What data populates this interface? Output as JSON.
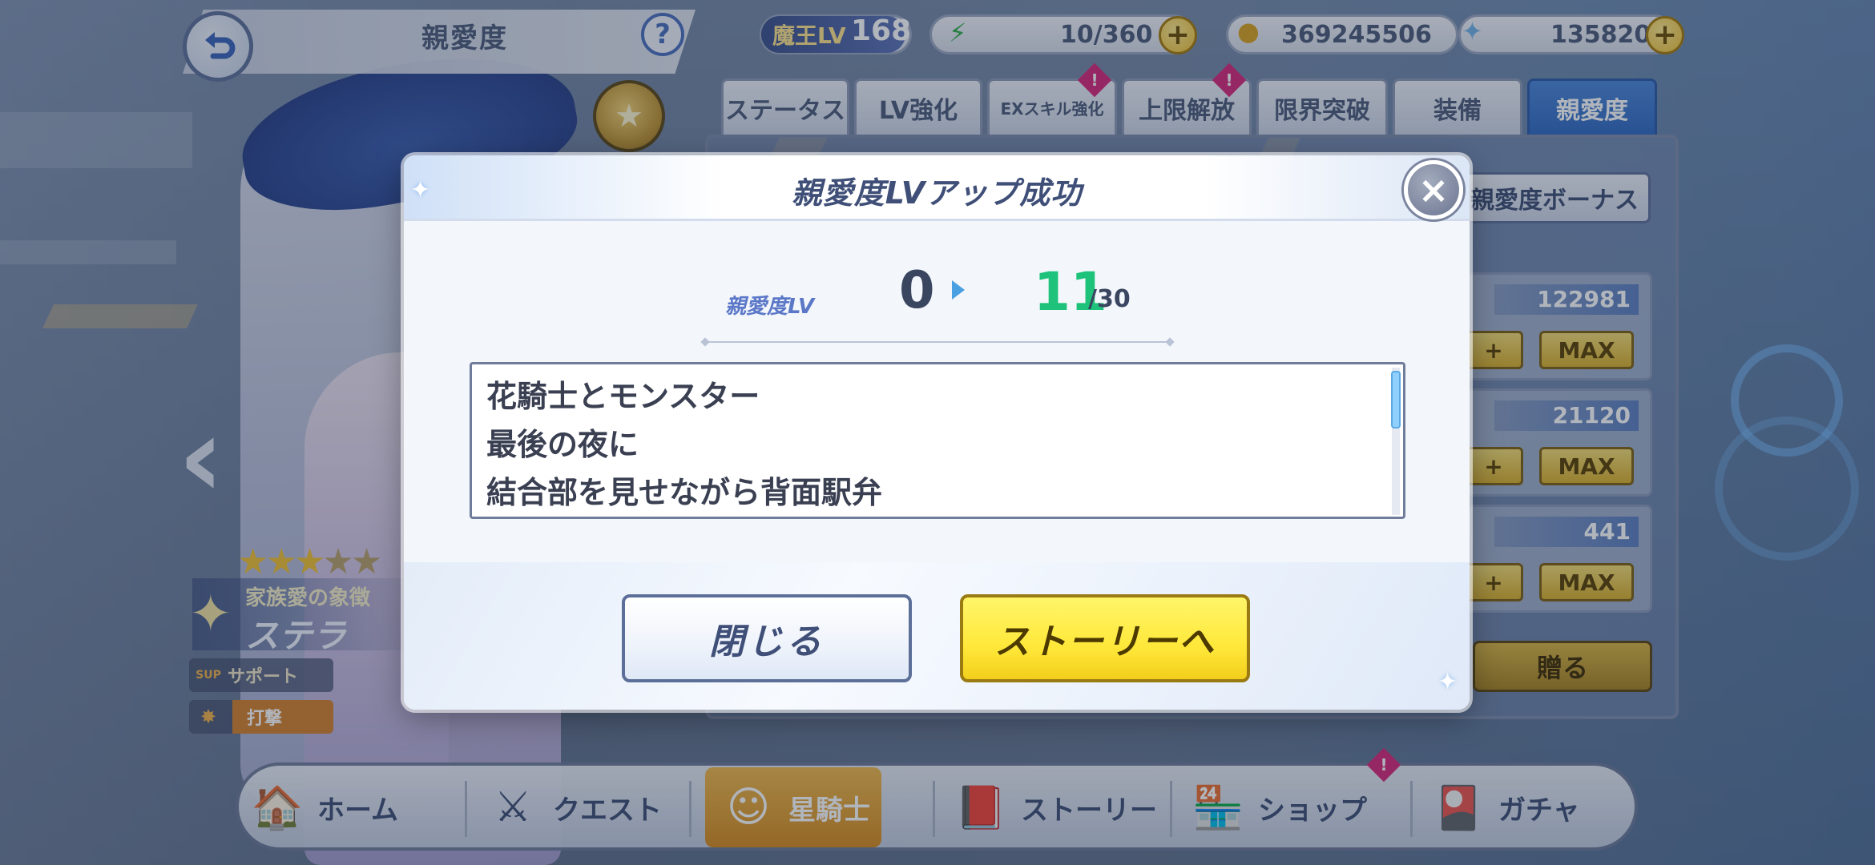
{
  "header": {
    "page_title": "親愛度",
    "back_icon": "back-arrow-icon",
    "help_label": "?",
    "player_level_label": "魔王LV",
    "player_level": "168",
    "stamina": "10/360",
    "coins": "369245506",
    "gems": "135820",
    "plus_label": "+"
  },
  "tabs": [
    {
      "label": "ステータス",
      "active": false,
      "badge": false
    },
    {
      "label": "LV強化",
      "active": false,
      "badge": false
    },
    {
      "label": "EXスキル強化",
      "active": false,
      "badge": true
    },
    {
      "label": "上限解放",
      "active": false,
      "badge": true
    },
    {
      "label": "限界突破",
      "active": false,
      "badge": false
    },
    {
      "label": "装備",
      "active": false,
      "badge": false
    },
    {
      "label": "親愛度",
      "active": true,
      "badge": false
    }
  ],
  "badge_mark": "!",
  "right_panel": {
    "bonus_button": "親愛度ボーナス",
    "items": [
      {
        "value": "122981",
        "plus": "+",
        "max": "MAX"
      },
      {
        "value": "21120",
        "plus": "+",
        "max": "MAX"
      },
      {
        "value": "441",
        "plus": "+",
        "max": "MAX"
      }
    ],
    "gift_button": "贈る"
  },
  "character": {
    "rarity_stars": 3,
    "rarity_max": 5,
    "subtitle": "家族愛の象徴",
    "name": "ステラ",
    "role": "サポート",
    "role_icon_label": "SUP",
    "attack_type": "打撃"
  },
  "modal": {
    "title": "親愛度LVアップ成功",
    "close_icon": "×",
    "level_label": "親愛度LV",
    "level_from": "0",
    "level_to": "11",
    "level_max": "/30",
    "story_lines": [
      "花騎士とモンスター",
      "最後の夜に",
      "結合部を見せながら背面駅弁"
    ],
    "close_button": "閉じる",
    "story_button": "ストーリーへ"
  },
  "bottom_nav": [
    {
      "label": "ホーム",
      "icon": "home-icon",
      "active": false
    },
    {
      "label": "クエスト",
      "icon": "quest-icon",
      "active": false
    },
    {
      "label": "星騎士",
      "icon": "knight-icon",
      "active": true
    },
    {
      "label": "ストーリー",
      "icon": "story-book-icon",
      "active": false
    },
    {
      "label": "ショップ",
      "icon": "shop-icon",
      "active": false
    },
    {
      "label": "ガチャ",
      "icon": "gacha-icon",
      "active": false
    }
  ],
  "colors": {
    "accent_blue": "#2f68c0",
    "level_green": "#1ec27a",
    "story_button_yellow": "#ffe83a",
    "badge_pink": "#d6287a"
  }
}
